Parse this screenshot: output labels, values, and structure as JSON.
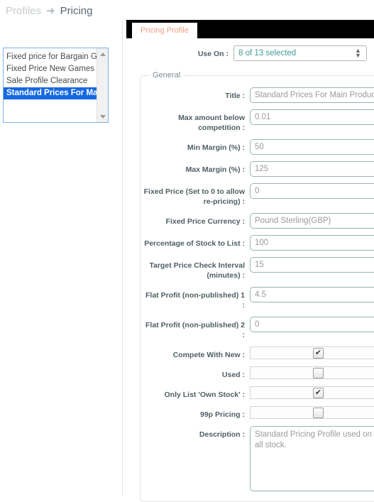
{
  "breadcrumb": {
    "parent": "Profiles",
    "arrow_icon": "arrow-right-icon",
    "current": "Pricing"
  },
  "profile_list": {
    "items": [
      {
        "label": "Fixed price for Bargain Games",
        "selected": false
      },
      {
        "label": "Fixed Price New Games",
        "selected": false
      },
      {
        "label": "Sale Profile Clearance",
        "selected": false
      },
      {
        "label": "Standard Prices For Main Products",
        "selected": true
      }
    ],
    "scroll_up_icon": "triangle-up-icon",
    "scroll_down_icon": "triangle-down-icon"
  },
  "tabs": [
    {
      "label": "Pricing Profile",
      "active": true
    }
  ],
  "use_on": {
    "label": "Use On :",
    "value": "8 of 13 selected",
    "stepper_icon": "up-down-stepper-icon"
  },
  "general": {
    "legend": "General",
    "fields": [
      {
        "label": "Title :",
        "value": "Standard Prices For Main Products",
        "type": "text"
      },
      {
        "label": "Max amount below competition :",
        "value": "0.01",
        "type": "text"
      },
      {
        "label": "Min Margin (%) :",
        "value": "50",
        "type": "text"
      },
      {
        "label": "Max Margin (%) :",
        "value": "125",
        "type": "text"
      },
      {
        "label": "Fixed Price (Set to 0 to allow re-pricing) :",
        "value": "0",
        "type": "text"
      },
      {
        "label": "Fixed Price Currency :",
        "value": "Pound Sterling(GBP)",
        "type": "select"
      },
      {
        "label": "Percentage of Stock to List :",
        "value": "100",
        "type": "text"
      },
      {
        "label": "Target Price Check Interval (minutes) :",
        "value": "15",
        "type": "text"
      },
      {
        "label": "Flat Profit (non-published) 1 :",
        "value": "4.5",
        "type": "text"
      },
      {
        "label": "Flat Profit (non-published) 2 :",
        "value": "0",
        "type": "text"
      },
      {
        "label": "Compete With New :",
        "value": "",
        "type": "checkbox",
        "checked": true
      },
      {
        "label": "Used :",
        "value": "",
        "type": "checkbox",
        "checked": false
      },
      {
        "label": "Only List 'Own Stock' :",
        "value": "",
        "type": "checkbox",
        "checked": true
      },
      {
        "label": "99p Pricing :",
        "value": "",
        "type": "checkbox",
        "checked": false
      },
      {
        "label": "Description :",
        "value": "Standard Pricing Profile used on all stock.",
        "type": "textarea"
      }
    ],
    "checkbox_check_glyph": "✔"
  },
  "colors": {
    "selection_blue": "#1569e0",
    "tab_text": "#f2a184",
    "tabbar_background": "#000000",
    "input_border": "#9ab3b5",
    "value_text": "#9b9b9b",
    "label_text": "#4f5f63",
    "useon_value_text": "#3f9e93"
  }
}
